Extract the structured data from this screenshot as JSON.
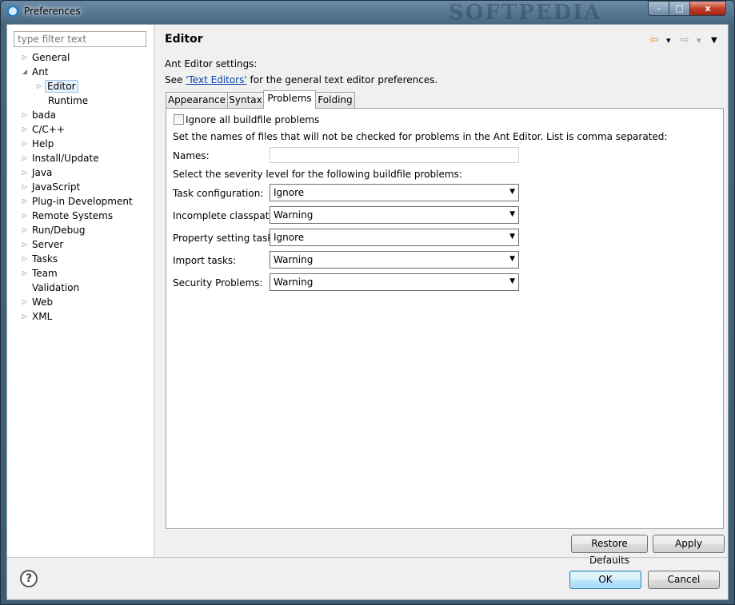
{
  "window": {
    "title": "Preferences",
    "watermark": "SOFTPEDIA",
    "min": "–",
    "max": "□",
    "close": "x"
  },
  "filter": {
    "placeholder": "type filter text"
  },
  "tree": [
    {
      "label": "General",
      "arrow": "▷"
    },
    {
      "label": "Ant",
      "arrow": "◢"
    },
    {
      "label": "Editor",
      "arrow": "▷"
    },
    {
      "label": "Runtime",
      "arrow": ""
    },
    {
      "label": "bada",
      "arrow": "▷"
    },
    {
      "label": "C/C++",
      "arrow": "▷"
    },
    {
      "label": "Help",
      "arrow": "▷"
    },
    {
      "label": "Install/Update",
      "arrow": "▷"
    },
    {
      "label": "Java",
      "arrow": "▷"
    },
    {
      "label": "JavaScript",
      "arrow": "▷"
    },
    {
      "label": "Plug-in Development",
      "arrow": "▷"
    },
    {
      "label": "Remote Systems",
      "arrow": "▷"
    },
    {
      "label": "Run/Debug",
      "arrow": "▷"
    },
    {
      "label": "Server",
      "arrow": "▷"
    },
    {
      "label": "Tasks",
      "arrow": "▷"
    },
    {
      "label": "Team",
      "arrow": "▷"
    },
    {
      "label": "Validation",
      "arrow": ""
    },
    {
      "label": "Web",
      "arrow": "▷"
    },
    {
      "label": "XML",
      "arrow": "▷"
    }
  ],
  "page": {
    "title": "Editor",
    "nav": {
      "back": "⇦",
      "forward": "⇨",
      "dropdown": "▾",
      "menu": "▼"
    },
    "intro": "Ant Editor settings:",
    "see_prefix": "See ",
    "see_link": "'Text Editors'",
    "see_suffix": " for the general text editor preferences."
  },
  "tabs": [
    "Appearance",
    "Syntax",
    "Problems",
    "Folding"
  ],
  "problems": {
    "ignore_all": "Ignore all buildfile problems",
    "names_desc": "Set the names of files that will not be checked for problems in the Ant Editor. List is comma separated:",
    "names_label": "Names:",
    "names_value": "",
    "severity_desc": "Select the severity level for the following buildfile problems:",
    "rows": [
      {
        "label": "Task configuration:",
        "value": "Ignore"
      },
      {
        "label": "Incomplete classpath:",
        "value": "Warning"
      },
      {
        "label": "Property setting tasks:",
        "value": "Ignore"
      },
      {
        "label": "Import tasks:",
        "value": "Warning"
      },
      {
        "label": "Security Problems:",
        "value": "Warning"
      }
    ]
  },
  "buttons": {
    "restore": "Restore Defaults",
    "apply": "Apply",
    "ok": "OK",
    "cancel": "Cancel",
    "help": "?"
  }
}
